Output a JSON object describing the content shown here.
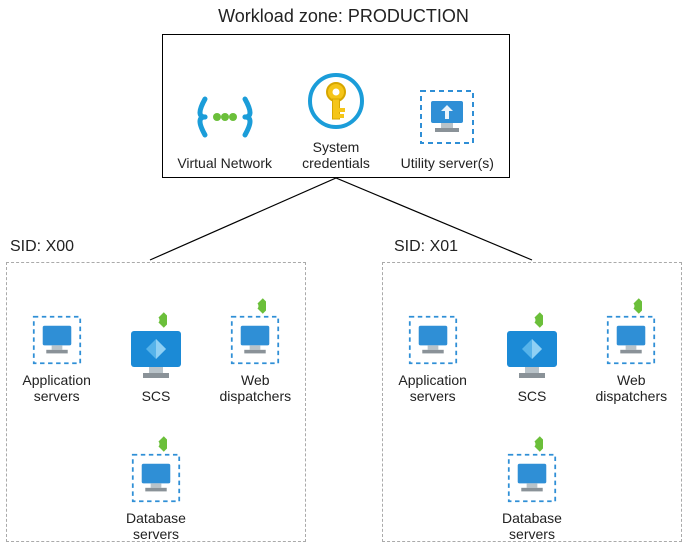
{
  "title": "Workload zone: PRODUCTION",
  "production": {
    "vnet_label": "Virtual Network",
    "creds_label": "System credentials",
    "utility_label": "Utility server(s)"
  },
  "sid_left": {
    "label": "SID: X00",
    "app_label": "Application servers",
    "scs_label": "SCS",
    "web_label": "Web dispatchers",
    "db_label": "Database servers"
  },
  "sid_right": {
    "label": "SID: X01",
    "app_label": "Application servers",
    "scs_label": "SCS",
    "web_label": "Web dispatchers",
    "db_label": "Database servers"
  },
  "icons": {
    "vnet": "virtual-network-icon",
    "key": "key-icon",
    "vm_dashed": "vm-dashed-icon",
    "monitor": "monitor-icon",
    "loadbalancer_badge": "load-balancer-badge-icon"
  }
}
